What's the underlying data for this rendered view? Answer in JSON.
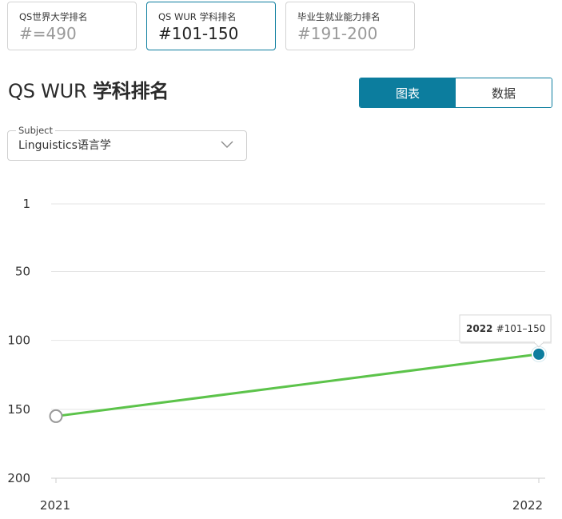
{
  "ranking_cards": [
    {
      "label": "QS世界大学排名",
      "value": "#=490",
      "active": false
    },
    {
      "label": "QS WUR 学科排名",
      "value": "#101-150",
      "active": true
    },
    {
      "label": "毕业生就业能力排名",
      "value": "#191-200",
      "active": false
    }
  ],
  "section": {
    "title_prefix": "QS WUR",
    "title_bold": "学科排名"
  },
  "view_toggle": {
    "chart_label": "图表",
    "data_label": "数据",
    "selected": "chart"
  },
  "subject_select": {
    "legend": "Subject",
    "value": "Linguistics语言学",
    "icon": "chevron-down-icon"
  },
  "colors": {
    "accent": "#0c7d9e",
    "line": "#5cc34a",
    "grid": "#e5e5e5"
  },
  "chart_data": {
    "type": "line",
    "x": [
      "2021",
      "2022"
    ],
    "series": [
      {
        "values": [
          155,
          110
        ]
      }
    ],
    "ylim": [
      1,
      200
    ],
    "y_inverted": true,
    "yticks": [
      "1",
      "50",
      "100",
      "150",
      "200"
    ],
    "grid": true,
    "tooltip": {
      "year": "2022",
      "rank": "#101–150"
    }
  }
}
